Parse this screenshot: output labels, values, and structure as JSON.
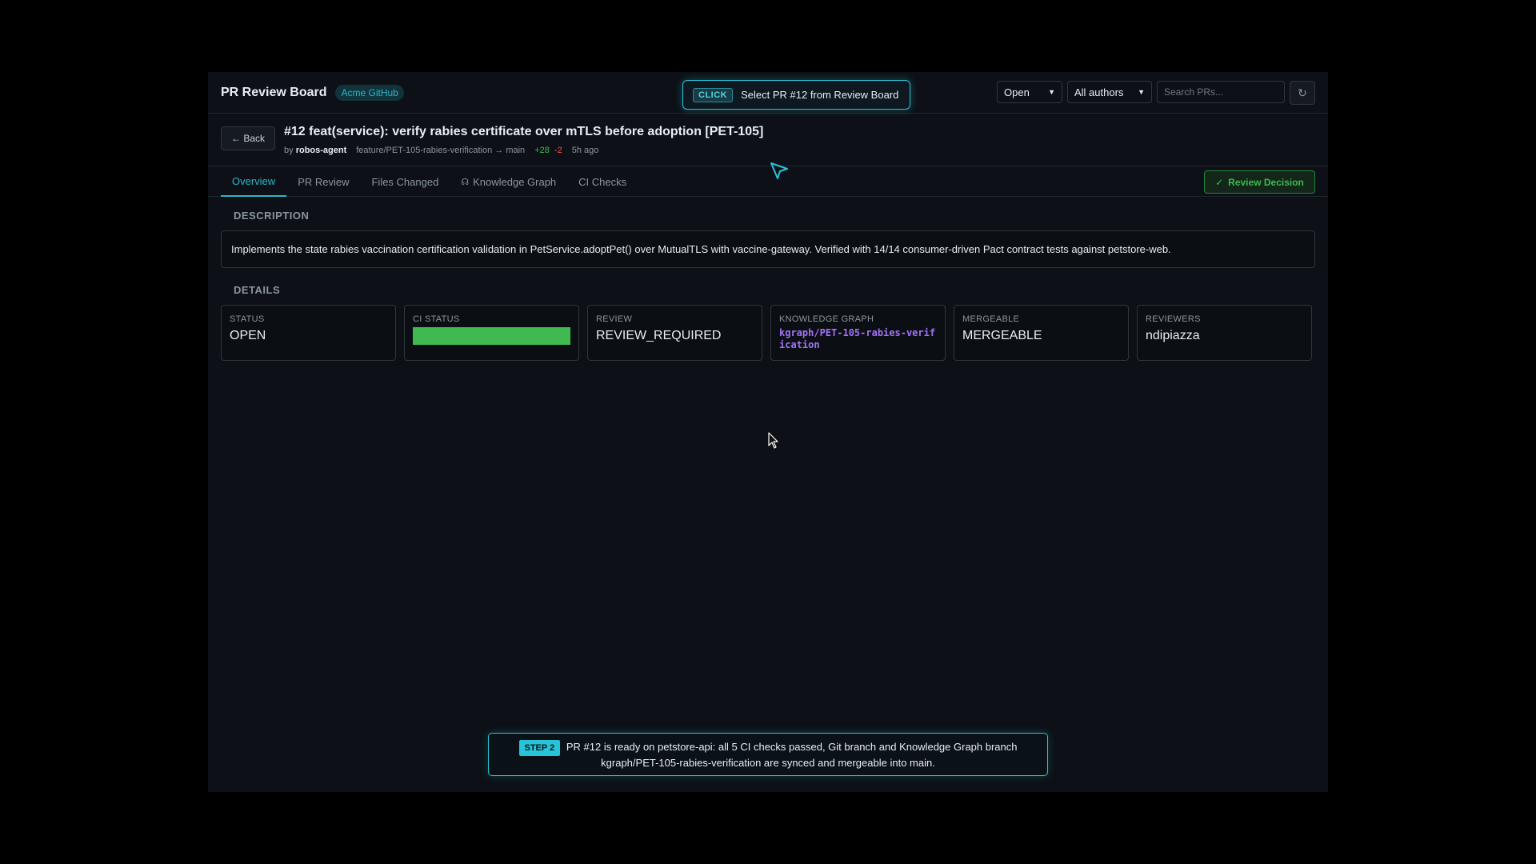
{
  "header": {
    "app_title": "PR Review Board",
    "org_badge": "Acme GitHub",
    "callout_tag": "CLICK",
    "callout_text": "Select PR #12 from Review Board",
    "status_filter": "Open",
    "author_filter": "All authors",
    "search_placeholder": "Search PRs...",
    "refresh_icon": "↻"
  },
  "pr": {
    "back_label": "← Back",
    "title": "#12 feat(service): verify rabies certificate over mTLS before adoption [PET-105]",
    "by_prefix": "by",
    "author": "robos-agent",
    "branch": "feature/PET-105-rabies-verification → main",
    "additions": "+28",
    "deletions": "-2",
    "age": "5h ago"
  },
  "tabs": [
    {
      "label": "Overview",
      "active": true
    },
    {
      "label": "PR Review"
    },
    {
      "label": "Files Changed"
    },
    {
      "label": "Knowledge Graph",
      "icon": "graph-icon"
    },
    {
      "label": "CI Checks"
    }
  ],
  "review_decision": {
    "check": "✓",
    "label": "Review Decision"
  },
  "description": {
    "heading": "DESCRIPTION",
    "text": "Implements the state rabies vaccination certification validation in PetService.adoptPet() over MutualTLS with vaccine-gateway. Verified with 14/14 consumer-driven Pact contract tests against petstore-web."
  },
  "details": {
    "heading": "DETAILS",
    "status_label": "STATUS",
    "status_value": "OPEN",
    "ci_label": "CI STATUS",
    "ci_pass_fraction": 1.0,
    "review_label": "REVIEW",
    "review_value": "REVIEW_REQUIRED",
    "kg_label": "KNOWLEDGE GRAPH",
    "kg_value": "kgraph/PET-105-rabies-verification",
    "mergeable_label": "MERGEABLE",
    "mergeable_value": "MERGEABLE",
    "reviewers_label": "REVIEWERS",
    "reviewers_value": "ndipiazza"
  },
  "step": {
    "tag": "STEP 2",
    "text": "PR #12 is ready on petstore-api: all 5 CI checks passed, Git branch and Knowledge Graph branch kgraph/PET-105-rabies-verification are synced and mergeable into main."
  },
  "colors": {
    "accent": "#2fb4c8",
    "success": "#3fb950",
    "kg_purple": "#a371f7",
    "background": "#0d1117"
  }
}
